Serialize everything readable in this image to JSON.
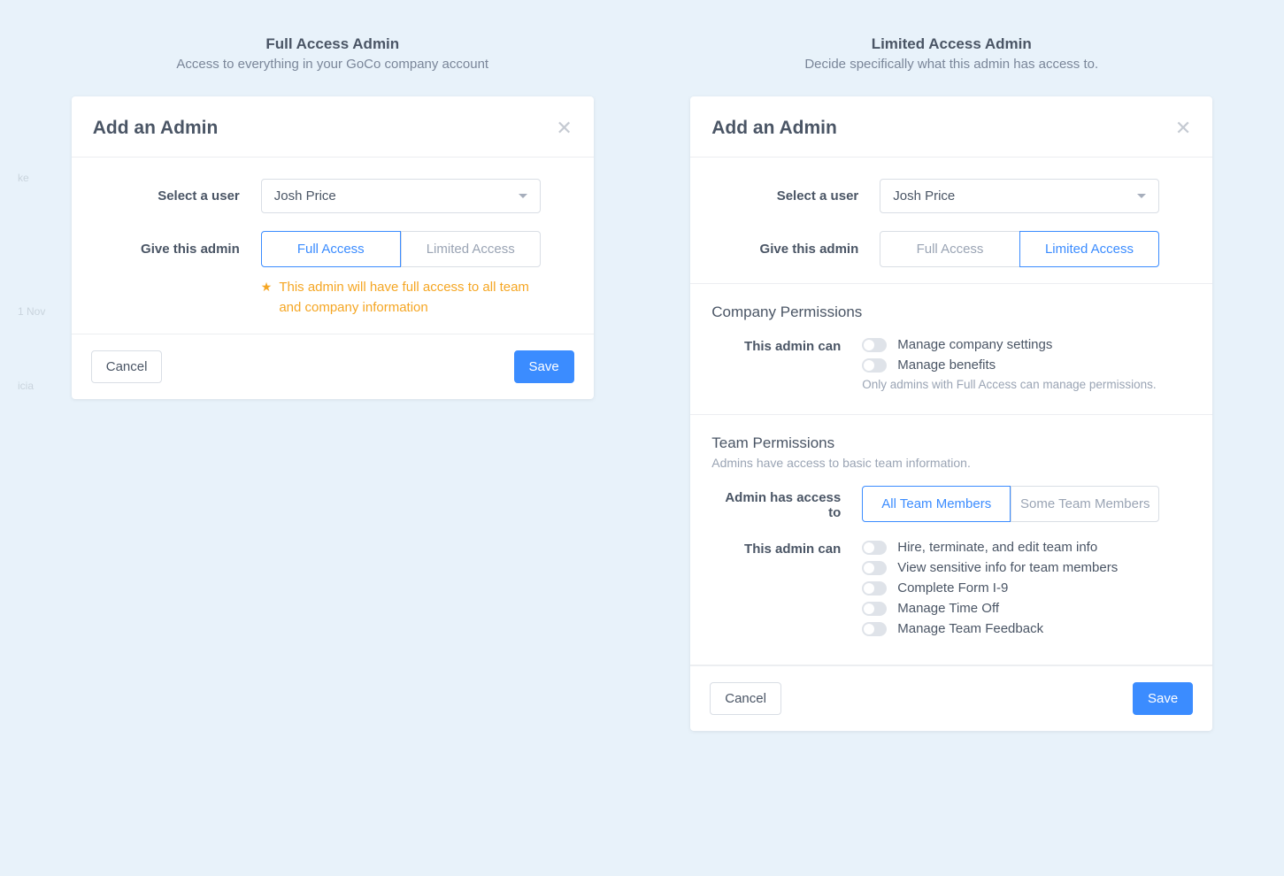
{
  "left": {
    "column_title": "Full Access Admin",
    "column_subtitle": "Access to everything in your GoCo company account",
    "modal_title": "Add an Admin",
    "select_user_label": "Select a user",
    "selected_user": "Josh Price",
    "give_label": "Give this admin",
    "seg_full": "Full Access",
    "seg_limited": "Limited Access",
    "note": "This admin will have full access to all team and company information",
    "cancel": "Cancel",
    "save": "Save"
  },
  "right": {
    "column_title": "Limited Access Admin",
    "column_subtitle": "Decide specifically what this admin has access to.",
    "modal_title": "Add an Admin",
    "select_user_label": "Select a user",
    "selected_user": "Josh Price",
    "give_label": "Give this admin",
    "seg_full": "Full Access",
    "seg_limited": "Limited Access",
    "company_perm_title": "Company Permissions",
    "this_admin_can": "This admin can",
    "company_perms": [
      "Manage company settings",
      "Manage benefits"
    ],
    "company_perm_help": "Only admins with Full Access can manage permissions.",
    "team_perm_title": "Team Permissions",
    "team_perm_sub": "Admins have access to basic team information.",
    "admin_access_to_label": "Admin has access to",
    "seg_all_members": "All Team Members",
    "seg_some_members": "Some Team Members",
    "team_perms": [
      "Hire, terminate, and edit team info",
      "View sensitive info for team members",
      "Complete Form I-9",
      "Manage Time Off",
      "Manage Team Feedback"
    ],
    "cancel": "Cancel",
    "save": "Save"
  }
}
